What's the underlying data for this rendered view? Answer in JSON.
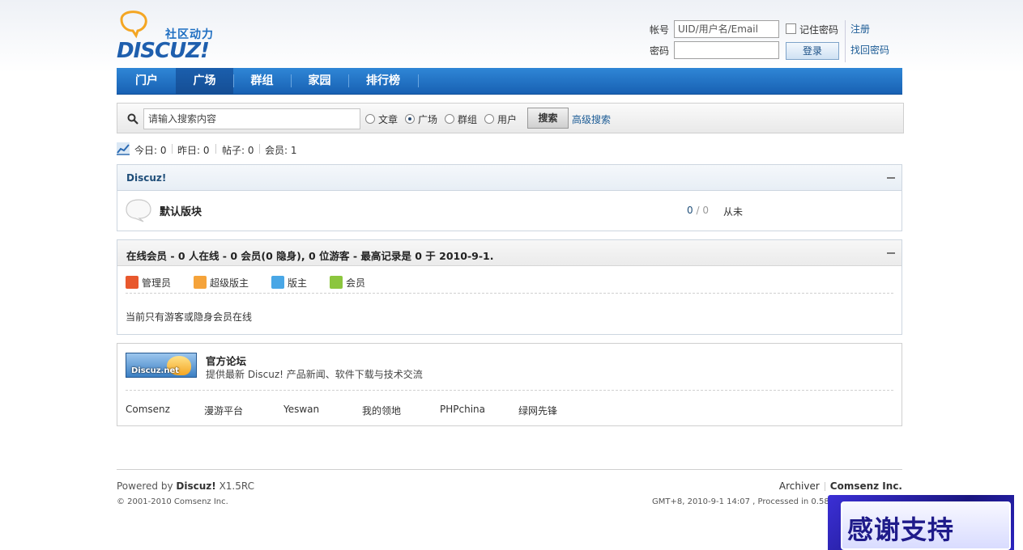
{
  "logo": {
    "slogan": "社区动力",
    "wordmark": "DISCUZ!"
  },
  "login": {
    "username_label": "帐号",
    "username_placeholder": "UID/用户名/Email",
    "password_label": "密码",
    "remember_label": "记住密码",
    "login_button": "登录",
    "register_link": "注册",
    "forgot_link": "找回密码"
  },
  "nav": {
    "items": [
      "门户",
      "广场",
      "群组",
      "家园",
      "排行榜"
    ],
    "active": "广场"
  },
  "search": {
    "placeholder": "请输入搜索内容",
    "options": [
      "文章",
      "广场",
      "群组",
      "用户"
    ],
    "selected": "广场",
    "button": "搜索",
    "advanced": "高级搜索"
  },
  "stats": {
    "today": "今日: 0",
    "yesterday": "昨日: 0",
    "posts": "帖子: 0",
    "members": "会员: 1"
  },
  "category": {
    "title": "Discuz!",
    "forum": {
      "name": "默认版块",
      "threads": "0",
      "posts": "0",
      "last_post": "从未"
    }
  },
  "online": {
    "title": "在线会员 - 0 人在线 - 0 会员(0 隐身), 0 位游客 - 最高记录是 0 于 2010-9-1.",
    "groups": [
      "管理员",
      "超级版主",
      "版主",
      "会员"
    ],
    "message": "当前只有游客或隐身会员在线"
  },
  "links": {
    "banner_text": "Discuz.net",
    "featured_name": "官方论坛",
    "featured_desc": "提供最新 Discuz! 产品新闻、软件下载与技术交流",
    "text_links": [
      "Comsenz",
      "漫游平台",
      "Yeswan",
      "我的领地",
      "PHPchina",
      "绿网先锋"
    ]
  },
  "footer": {
    "powered_prefix": "Powered by",
    "powered_name": "Discuz!",
    "version": "X1.5RC",
    "copyright": "© 2001-2010 Comsenz Inc.",
    "archiver": "Archiver",
    "company": "Comsenz Inc.",
    "gmt": "GMT+8, 2010-9-1 14:07 , Processed in 0.584431 s"
  },
  "overlay": {
    "text": "感谢支持"
  },
  "colors": {
    "nav_blue": "#1f6fc2",
    "link_blue": "#1b5b95",
    "logo_orange": "#f4a623"
  }
}
